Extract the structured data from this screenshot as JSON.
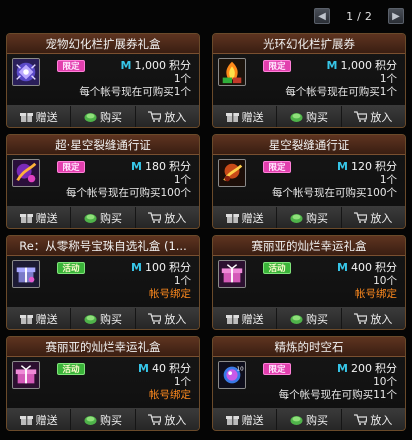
{
  "pager": {
    "current": "1",
    "separator": "/",
    "total": "2",
    "prev_icon": "triangle-left-icon",
    "next_icon": "triangle-right-icon"
  },
  "labels": {
    "gift": "赠送",
    "buy": "购买",
    "cart": "放入",
    "currency_symbol": "M",
    "currency_unit": "积分"
  },
  "colors": {
    "limited_badge": "#e23fae",
    "event_badge": "#3bb43a",
    "bound_text": "#ff8a1e",
    "currency": "#37c6e8"
  },
  "items": [
    {
      "title": "宠物幻化栏扩展券礼盒",
      "badge": "限定",
      "badge_type": "limited",
      "price": "1,000",
      "qty": "1个",
      "note": "每个帐号现在可购买1个",
      "note_type": "normal",
      "icon": "pet-gift-icon"
    },
    {
      "title": "光环幻化栏扩展券",
      "badge": "限定",
      "badge_type": "limited",
      "price": "1,000",
      "qty": "1个",
      "note": "每个帐号现在可购买1个",
      "note_type": "normal",
      "icon": "aura-ticket-icon"
    },
    {
      "title": "超·星空裂缝通行证",
      "badge": "限定",
      "badge_type": "limited",
      "price": "180",
      "qty": "1个",
      "note": "每个帐号现在可购买100个",
      "note_type": "normal",
      "icon": "super-rift-pass-icon"
    },
    {
      "title": "星空裂缝通行证",
      "badge": "限定",
      "badge_type": "limited",
      "price": "120",
      "qty": "1个",
      "note": "每个帐号现在可购买100个",
      "note_type": "normal",
      "icon": "rift-pass-icon"
    },
    {
      "title": "Re：从零称号宝珠自选礼盒 (1...",
      "badge": "活动",
      "badge_type": "event",
      "price": "100",
      "qty": "1个",
      "note": "帐号绑定",
      "note_type": "bound",
      "icon": "title-orb-box-icon"
    },
    {
      "title": "赛丽亚的灿烂幸运礼盒",
      "badge": "活动",
      "badge_type": "event",
      "price": "400",
      "qty": "10个",
      "note": "帐号绑定",
      "note_type": "bound",
      "icon": "seria-lucky-box-icon"
    },
    {
      "title": "赛丽亚的灿烂幸运礼盒",
      "badge": "活动",
      "badge_type": "event",
      "price": "40",
      "qty": "1个",
      "note": "帐号绑定",
      "note_type": "bound",
      "icon": "seria-lucky-box-icon"
    },
    {
      "title": "精炼的时空石",
      "badge": "限定",
      "badge_type": "limited",
      "price": "200",
      "qty": "10个",
      "note": "每个帐号现在可购买11个",
      "note_type": "normal",
      "icon": "spacetime-stone-icon"
    }
  ]
}
